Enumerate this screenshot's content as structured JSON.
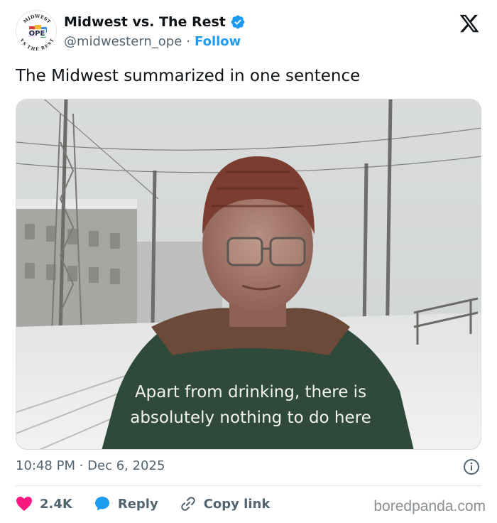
{
  "account": {
    "avatar_top_text": "MIDWEST",
    "avatar_center_text": "OPE",
    "avatar_bottom_text": "VS THE REST",
    "display_name": "Midwest vs. The Rest",
    "handle": "@midwestern_ope",
    "separator": "·",
    "follow_label": "Follow",
    "verified": true
  },
  "tweet": {
    "text": "The Midwest summarized in one sentence",
    "image_caption_line1": "Apart from drinking, there is",
    "image_caption_line2": "absolutely nothing to do here",
    "timestamp": "10:48 PM · Dec 6, 2025"
  },
  "actions": {
    "likes": "2.4K",
    "reply_label": "Reply",
    "copy_label": "Copy link"
  },
  "watermark": "boredpanda.com",
  "colors": {
    "accent": "#1d9bf0",
    "like": "#f91880",
    "secondary_text": "#536471"
  }
}
